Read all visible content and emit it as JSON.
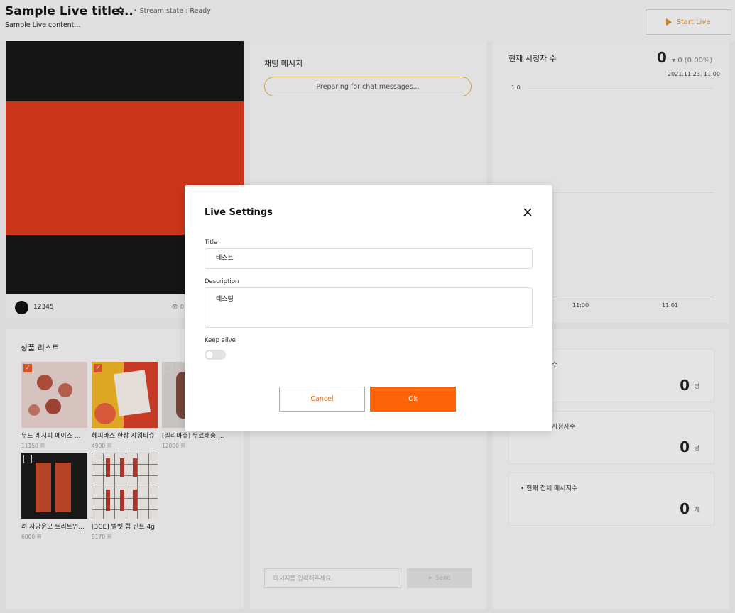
{
  "header": {
    "title": "Sample Live title...",
    "stream_state": "• Stream state : Ready",
    "content": "Sample Live content...",
    "start_live_label": "Start Live"
  },
  "video": {
    "user": "12345",
    "viewers": "0"
  },
  "chat": {
    "title": "채팅 메시지",
    "preparing": "Preparing for chat messages...",
    "input_placeholder": "메시지를 입력해주세요.",
    "send_label": "Send"
  },
  "viewers": {
    "title": "현재 시청자 수",
    "count": "0",
    "delta": "0 (0.00%)",
    "timestamp": "2021.11.23. 11:00",
    "y_tick": "1.0",
    "x_ticks": [
      "11:00",
      "11:01"
    ]
  },
  "stats": {
    "cards": [
      {
        "label": "수",
        "value": "0",
        "unit": "명"
      },
      {
        "label": "시청자수",
        "value": "0",
        "unit": "명"
      },
      {
        "label": "• 현재 전체 메시지수",
        "value": "0",
        "unit": "개"
      }
    ]
  },
  "products": {
    "title": "상품 리스트",
    "items": [
      {
        "name": "무드 레시피 페이스 ...",
        "price": "11150 원",
        "checked": true
      },
      {
        "name": "헤피바스 한장 샤워티슈",
        "price": "4900 원",
        "checked": true
      },
      {
        "name": "[밀리마쥬] 무료배송 ...",
        "price": "12000 원",
        "checked": false
      },
      {
        "name": "려 자양윤모 트리트먼...",
        "price": "6000 원",
        "checked": false
      },
      {
        "name": "[3CE] 벨벳 립 틴트 4g",
        "price": "9170 원",
        "checked": false
      }
    ]
  },
  "modal": {
    "title": "Live Settings",
    "title_label": "Title",
    "title_value": "테스트",
    "description_label": "Description",
    "description_value": "테스팅",
    "keep_alive_label": "Keep alive",
    "keep_alive_on": false,
    "cancel_label": "Cancel",
    "ok_label": "Ok"
  },
  "colors": {
    "accent": "#ff6308",
    "video_red": "#dd3b1e",
    "video_dark": "#171717"
  }
}
